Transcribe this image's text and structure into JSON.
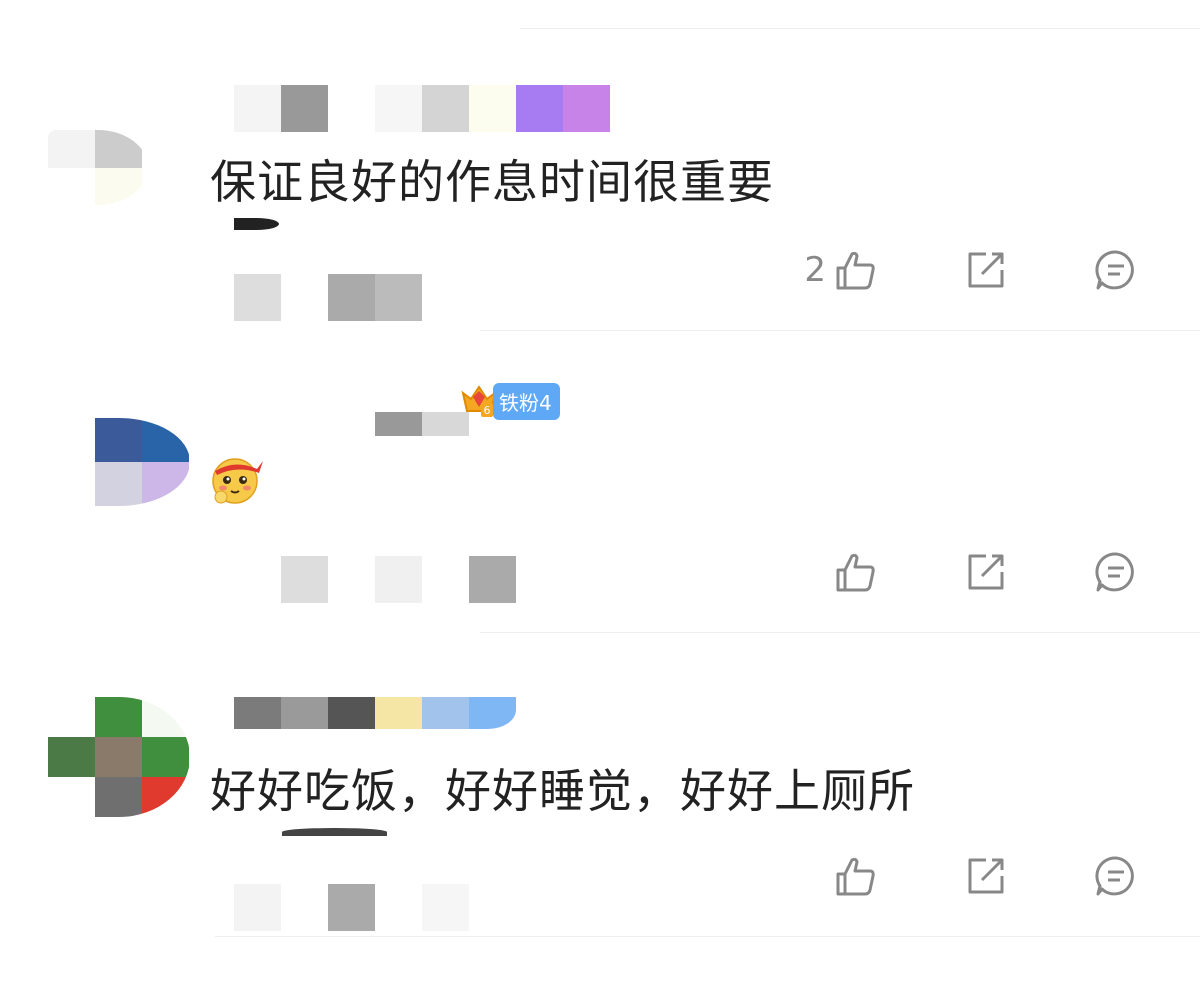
{
  "comments": [
    {
      "text": "保证良好的作息时间很重要",
      "like_count": "2",
      "icons": {
        "like": "thumbs-up-icon",
        "share": "share-icon",
        "reply": "reply-bubble-icon"
      }
    },
    {
      "text": "",
      "emoji": "blushing-emoji",
      "badge": {
        "label": "铁粉4",
        "level": "6",
        "icon": "crown-gem-icon"
      },
      "like_count": "",
      "icons": {
        "like": "thumbs-up-icon",
        "share": "share-icon",
        "reply": "reply-bubble-icon"
      }
    },
    {
      "text": "好好吃饭，好好睡觉，好好上厕所",
      "like_count": "",
      "icons": {
        "like": "thumbs-up-icon",
        "share": "share-icon",
        "reply": "reply-bubble-icon"
      }
    }
  ],
  "colors": {
    "icon_gray": "#888888",
    "text": "#222222",
    "badge_blue": "#5fa8f5",
    "divider": "#eeeeee"
  }
}
